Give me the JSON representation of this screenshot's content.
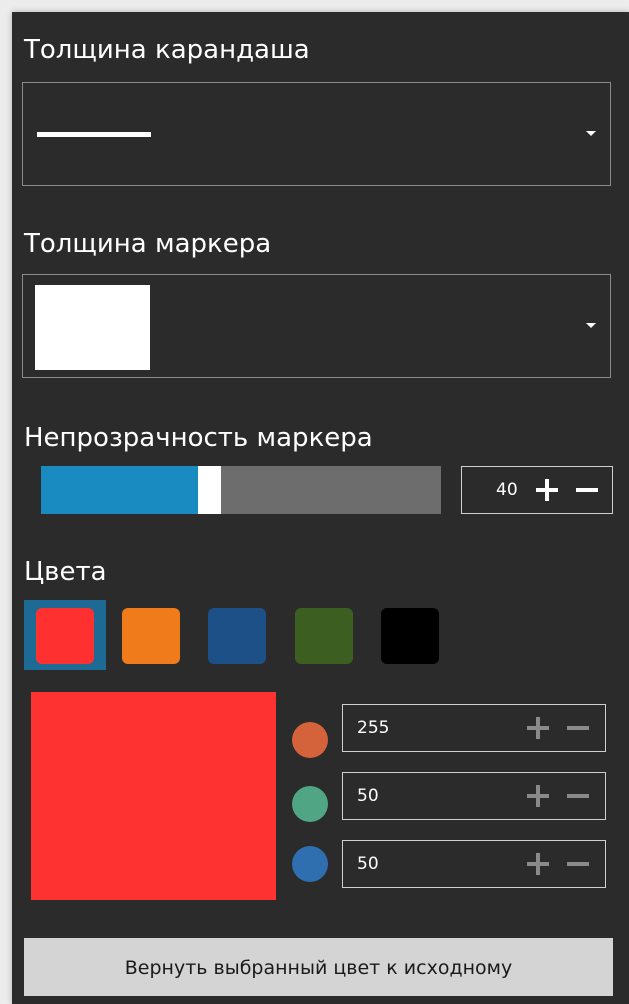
{
  "pencil": {
    "title": "Толщина карандаша"
  },
  "marker": {
    "title": "Толщина маркера"
  },
  "opacity": {
    "title": "Непрозрачность маркера",
    "value": "40",
    "fraction": 0.4
  },
  "colors": {
    "title": "Цвета",
    "swatches": [
      {
        "name": "red",
        "hex": "#ff3030",
        "selected": true
      },
      {
        "name": "orange",
        "hex": "#f07b1a"
      },
      {
        "name": "blue",
        "hex": "#1e5088"
      },
      {
        "name": "green",
        "hex": "#3c5e21"
      },
      {
        "name": "black",
        "hex": "#000000"
      }
    ],
    "preview_hex": "#ff3232",
    "channels": [
      {
        "name": "red",
        "dot_hex": "#d4623b",
        "value": "255"
      },
      {
        "name": "green",
        "dot_hex": "#50a585",
        "value": "50"
      },
      {
        "name": "blue",
        "dot_hex": "#2f6fb0",
        "value": "50"
      }
    ]
  },
  "reset_label": "Вернуть выбранный цвет к исходному"
}
